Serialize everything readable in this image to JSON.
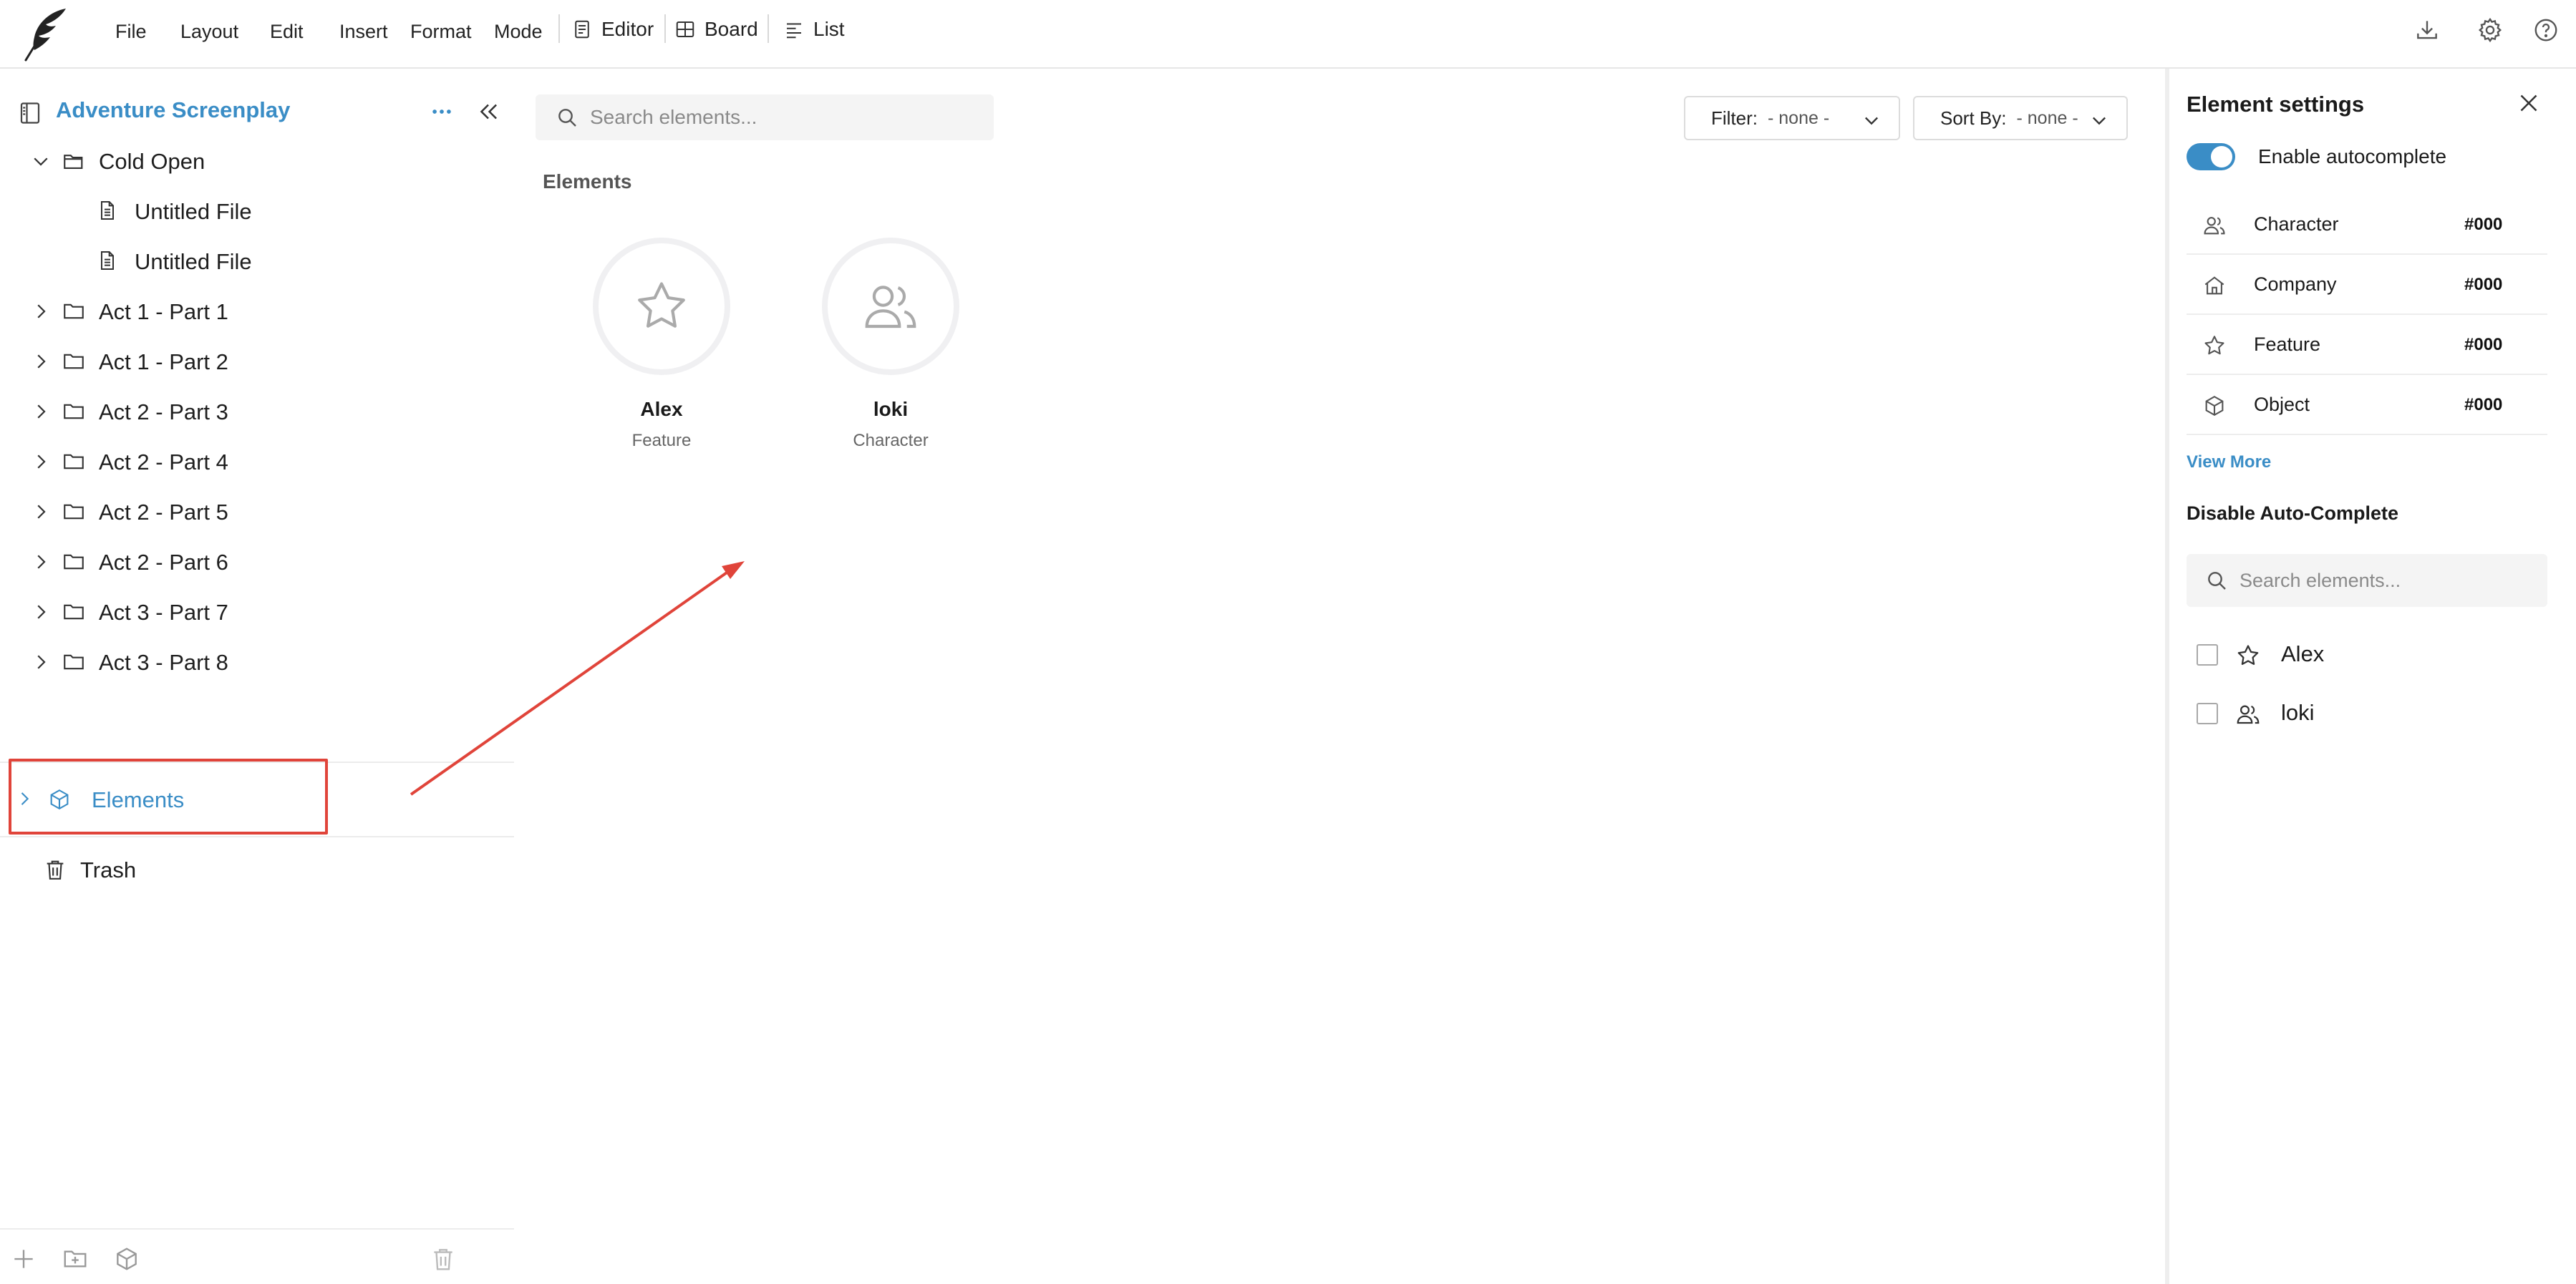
{
  "menu": {
    "file": "File",
    "layout": "Layout",
    "edit": "Edit",
    "insert": "Insert",
    "format": "Format",
    "mode": "Mode"
  },
  "views": {
    "editor": "Editor",
    "board": "Board",
    "list": "List"
  },
  "sidebar": {
    "project_title": "Adventure Screenplay",
    "tree": [
      {
        "label": "Cold Open",
        "expanded": true
      },
      {
        "label": "Untitled File"
      },
      {
        "label": "Untitled File"
      },
      {
        "label": "Act 1 - Part 1"
      },
      {
        "label": "Act 1 - Part 2"
      },
      {
        "label": "Act 2 - Part 3"
      },
      {
        "label": "Act 2 - Part 4"
      },
      {
        "label": "Act 2 - Part 5"
      },
      {
        "label": "Act 2 - Part 6"
      },
      {
        "label": "Act 3 - Part 7"
      },
      {
        "label": "Act 3 - Part 8"
      }
    ],
    "elements_label": "Elements",
    "trash_label": "Trash"
  },
  "main": {
    "search_placeholder": "Search elements...",
    "filter_label": "Filter:",
    "filter_value": "- none -",
    "sort_label": "Sort By:",
    "sort_value": "- none -",
    "section_title": "Elements",
    "elements": [
      {
        "name": "Alex",
        "type": "Feature",
        "icon": "star-icon"
      },
      {
        "name": "loki",
        "type": "Character",
        "icon": "users-icon"
      }
    ]
  },
  "settings": {
    "title": "Element settings",
    "autocomplete_label": "Enable autocomplete",
    "autocomplete_enabled": true,
    "types": [
      {
        "name": "Character",
        "color": "#000",
        "icon": "users-icon"
      },
      {
        "name": "Company",
        "color": "#000",
        "icon": "home-icon"
      },
      {
        "name": "Feature",
        "color": "#000",
        "icon": "star-icon"
      },
      {
        "name": "Object",
        "color": "#000",
        "icon": "cube-icon"
      }
    ],
    "view_more": "View More",
    "disable_title": "Disable Auto-Complete",
    "search_placeholder": "Search elements...",
    "disable_items": [
      {
        "name": "Alex",
        "icon": "star-icon",
        "checked": false
      },
      {
        "name": "loki",
        "icon": "users-icon",
        "checked": false
      }
    ]
  },
  "colors": {
    "accent": "#3a8dc6",
    "highlight": "#e0443a"
  }
}
